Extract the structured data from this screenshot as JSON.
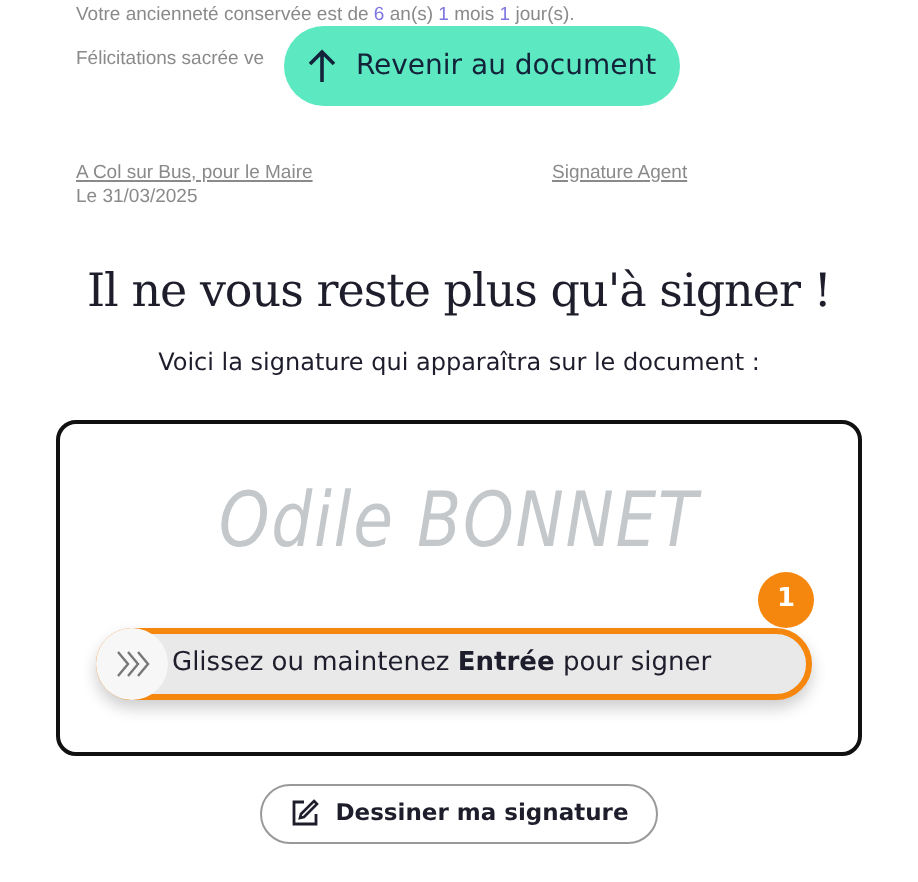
{
  "document_background": {
    "seniority_line": [
      {
        "kind": "plain",
        "text": "Votre ancienneté conservée est de"
      },
      {
        "kind": "value",
        "text": "6"
      },
      {
        "kind": "plain",
        "text": "an(s)"
      },
      {
        "kind": "value",
        "text": "1"
      },
      {
        "kind": "plain",
        "text": "mois"
      },
      {
        "kind": "value",
        "text": "1"
      },
      {
        "kind": "plain",
        "text": "jour(s)."
      }
    ],
    "congrats_line": "Félicitations sacrée ve",
    "place_line": "A Col sur Bus, pour le Maire",
    "signature_label": "Signature Agent",
    "date_line": "Le 31/03/2025"
  },
  "back_button": {
    "label": "Revenir au document"
  },
  "heading": "Il ne vous reste plus qu'à signer !",
  "subtitle": "Voici la signature qui apparaîtra sur le document :",
  "signature": {
    "name": "Odile BONNET"
  },
  "sign_slider": {
    "label": "Glissez ou maintenez **Entrée** pour signer",
    "level": 0,
    "step_badge": "1"
  },
  "draw_button": {
    "label": "Dessiner ma signature"
  }
}
